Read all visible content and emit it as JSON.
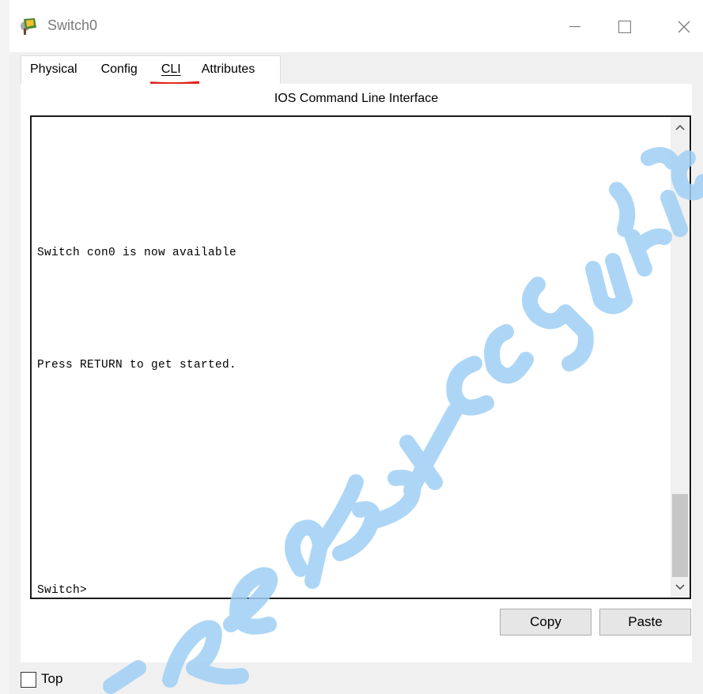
{
  "window": {
    "title": "Switch0",
    "icon": "switch-device-icon",
    "controls": [
      "minimize-icon",
      "maximize-icon",
      "close-icon"
    ]
  },
  "tabs": [
    {
      "label": "Physical",
      "active": false
    },
    {
      "label": "Config",
      "active": false
    },
    {
      "label": "CLI",
      "active": true
    },
    {
      "label": "Attributes",
      "active": false
    }
  ],
  "panel": {
    "title": "IOS Command Line Interface"
  },
  "terminal": {
    "lines": [
      "Switch con0 is now available",
      "Press RETURN to get started.",
      "Switch>"
    ]
  },
  "buttons": {
    "copy": "Copy",
    "paste": "Paste"
  },
  "footer": {
    "top_label": "Top",
    "top_checked": false
  },
  "colors": {
    "cli_underline": "#e2231a",
    "watermark": "#9fd0f5"
  }
}
